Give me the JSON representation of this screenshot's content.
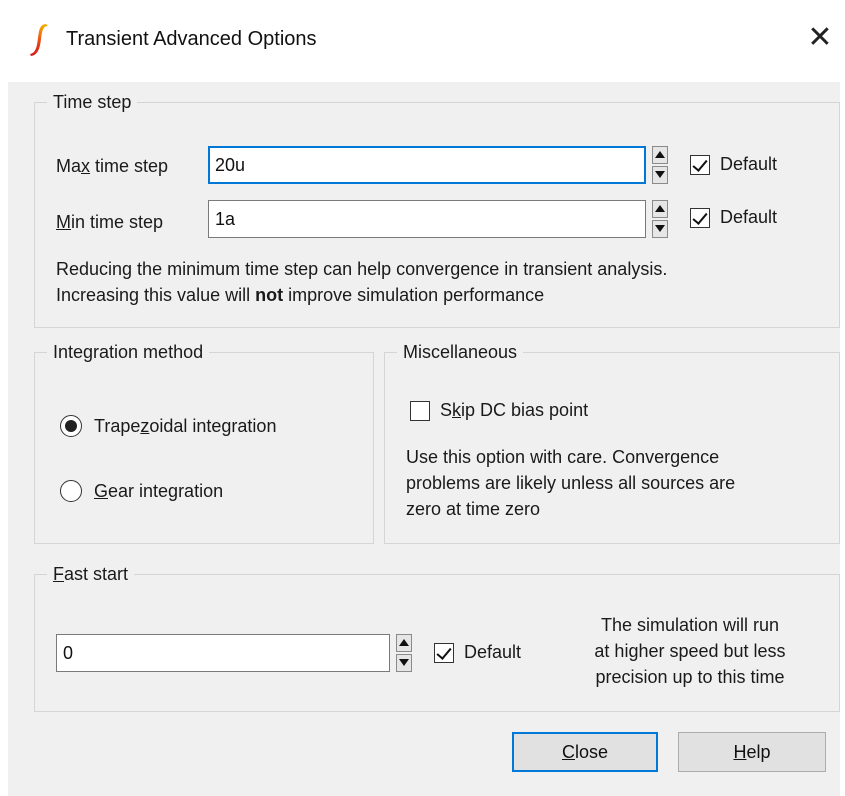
{
  "window": {
    "title": "Transient Advanced Options",
    "close_glyph": "✕",
    "accent_color": "#0078d7"
  },
  "time_step": {
    "legend": "Time step",
    "max": {
      "label_before": "Ma",
      "label_mnemonic": "x",
      "label_after": " time step",
      "value": "20u",
      "default_label": "Default",
      "default_checked": true
    },
    "min": {
      "label_before": "",
      "label_mnemonic": "M",
      "label_after": "in time step",
      "value": "1a",
      "default_label": "Default",
      "default_checked": true
    },
    "note_line1": "Reducing the minimum time step can help convergence in transient analysis.",
    "note_line2_before": "Increasing this value will ",
    "note_line2_bold": "not",
    "note_line2_after": " improve simulation performance"
  },
  "integration": {
    "legend": "Integration method",
    "options": [
      {
        "before": "Trape",
        "mnemonic": "z",
        "after": "oidal integration",
        "selected": true
      },
      {
        "before": "",
        "mnemonic": "G",
        "after": "ear integration",
        "selected": false
      }
    ]
  },
  "misc": {
    "legend": "Miscellaneous",
    "skip_before": "S",
    "skip_mnemonic": "k",
    "skip_after": "ip DC bias point",
    "skip_checked": false,
    "note_lines": [
      "Use this option with care. Convergence",
      "problems are likely unless all sources are",
      "zero at time zero"
    ]
  },
  "fast_start": {
    "legend_mnemonic": "F",
    "legend_after": "ast start",
    "value": "0",
    "default_label": "Default",
    "default_checked": true,
    "note_lines": [
      "The simulation will run",
      "at higher speed but less",
      "precision up to this time"
    ]
  },
  "buttons": {
    "close_mnemonic": "C",
    "close_after": "lose",
    "help_mnemonic": "H",
    "help_after": "elp"
  }
}
